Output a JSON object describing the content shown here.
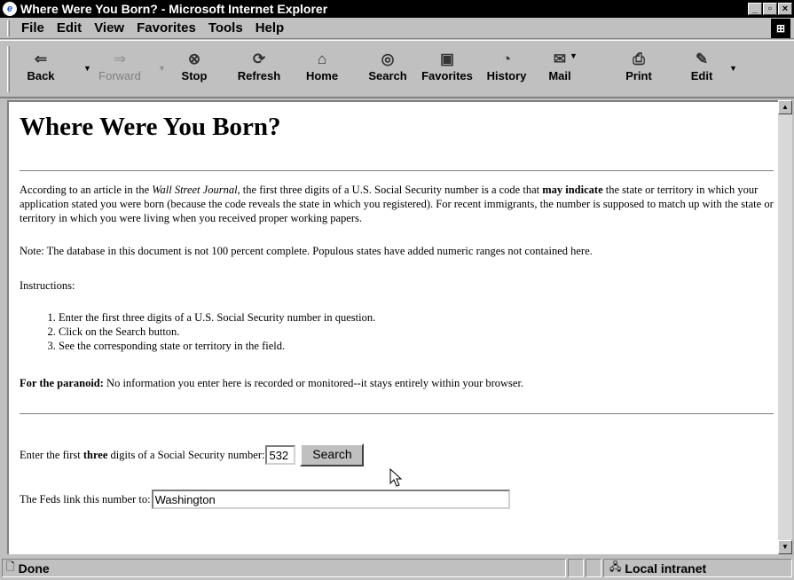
{
  "window": {
    "title": "Where Were You Born? - Microsoft Internet Explorer",
    "buttons": [
      "_",
      "▫",
      "×"
    ]
  },
  "menu": [
    {
      "label": "File"
    },
    {
      "label": "Edit"
    },
    {
      "label": "View"
    },
    {
      "label": "Favorites"
    },
    {
      "label": "Tools"
    },
    {
      "label": "Help"
    }
  ],
  "toolbar": {
    "back": "Back",
    "forward": "Forward",
    "stop": "Stop",
    "refresh": "Refresh",
    "home": "Home",
    "search": "Search",
    "favorites": "Favorites",
    "history": "History",
    "mail": "Mail",
    "print": "Print",
    "edit": "Edit"
  },
  "page": {
    "heading": "Where Were You Born?",
    "intro": {
      "p1": "According to an article in the ",
      "journal": "Wall Street Journal",
      "p2": ", the first three digits of a U.S. Social Security number is a code that ",
      "bold": "may indicate",
      "p3": " the state or territory in which your application stated you were born (because the code reveals the state in which you registered). For recent immigrants, the number is supposed to match up with the state or territory in which you were living when you received proper working papers."
    },
    "note": "Note: The database in this document is not 100 percent complete. Populous states have added numeric ranges not contained here.",
    "instructions_label": "Instructions:",
    "steps": [
      "Enter the first three digits of a U.S. Social Security number in question.",
      "Click on the Search button.",
      "See the corresponding state or territory in the field."
    ],
    "paranoid_label": "For the paranoid:",
    "paranoid_text": " No information you enter here is recorded or monitored--it stays entirely within your browser.",
    "form": {
      "ssn_prefix": "Enter the first ",
      "ssn_bold": "three",
      "ssn_suffix": " digits of a Social Security number:",
      "ssn_value": "532",
      "search_button": "Search",
      "result_label": "The Feds link this number to:",
      "result_value": "Washington"
    }
  },
  "status": {
    "text": "Done",
    "zone": "Local intranet"
  }
}
